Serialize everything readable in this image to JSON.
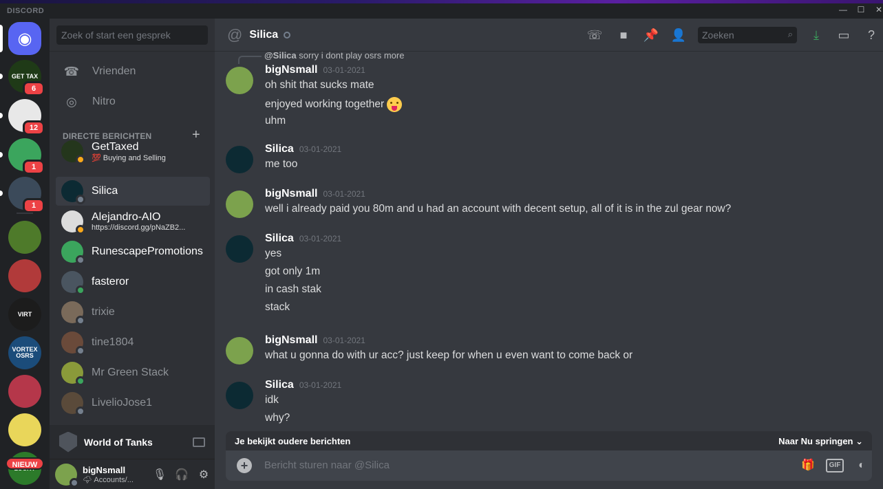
{
  "window": {
    "brand": "DISCORD",
    "minimize": "—",
    "maximize": "☐",
    "close": "✕"
  },
  "guilds": {
    "items": [
      {
        "name": "home",
        "label": "",
        "color": "#5865f2",
        "badge": ""
      },
      {
        "name": "gettax-server",
        "label": "GET TAX",
        "color": "#1f3a17",
        "badge": "6"
      },
      {
        "name": "dots-server",
        "label": "",
        "color": "#e8e8e8",
        "badge": "12"
      },
      {
        "name": "discord-green-server",
        "label": "",
        "color": "#3ba55d",
        "badge": "1"
      },
      {
        "name": "car-server",
        "label": "",
        "color": "#3b4a5a",
        "badge": "1"
      },
      {
        "name": "tree-server",
        "label": "",
        "color": "#4e7a2a",
        "badge": ""
      },
      {
        "name": "flag-server",
        "label": "",
        "color": "#b13a3a",
        "badge": ""
      },
      {
        "name": "virt-server",
        "label": "VIRT",
        "color": "#1c1c1c",
        "badge": ""
      },
      {
        "name": "vortex-server",
        "label": "VORTEX OSRS",
        "color": "#1b4c7a",
        "badge": ""
      },
      {
        "name": "bull-server",
        "label": "",
        "color": "#b5374a",
        "badge": ""
      },
      {
        "name": "cartoon-server",
        "label": "",
        "color": "#e9d65a",
        "badge": ""
      },
      {
        "name": "lucky-server",
        "label": "LUCKY",
        "color": "#2c7a2a",
        "badge": ""
      }
    ],
    "new_label": "NIEUW"
  },
  "sidebar": {
    "search_placeholder": "Zoek of start een gesprek",
    "nav": [
      {
        "label": "Vrienden"
      },
      {
        "label": "Nitro"
      }
    ],
    "dm_header": "DIRECTE BERICHTEN",
    "dm_add": "+",
    "dms": [
      {
        "name": "GetTaxed",
        "sub": "💯 Buying and Selling",
        "color": "#24361c",
        "status": "idle",
        "bright": true
      },
      {
        "name": "Silica",
        "sub": "",
        "color": "#0c2a33",
        "status": "off",
        "active": true
      },
      {
        "name": "Alejandro-AIO",
        "sub": "https://discord.gg/pNaZB2...",
        "color": "#dcdcdc",
        "status": "idle",
        "bright": true
      },
      {
        "name": "RunescapePromotions",
        "sub": "",
        "color": "#3ba55d",
        "status": "off",
        "bright": true
      },
      {
        "name": "fasteror",
        "sub": "",
        "color": "#4a5560",
        "status": "on",
        "bright": true
      },
      {
        "name": "trixie",
        "sub": "",
        "color": "#7a6a5a",
        "status": "off"
      },
      {
        "name": "tine1804",
        "sub": "",
        "color": "#6a4a3a",
        "status": "off"
      },
      {
        "name": "Mr Green Stack",
        "sub": "",
        "color": "#8a9a3a",
        "status": "on"
      },
      {
        "name": "LivelioJose1",
        "sub": "",
        "color": "#5a4a3a",
        "status": "off"
      }
    ],
    "game": {
      "name": "World of Tanks"
    },
    "user": {
      "name": "bigNsmall",
      "status": "🌩 Accounts/...",
      "mic": "🎙",
      "headset": "🎧",
      "settings": "⚙"
    }
  },
  "header": {
    "at": "@",
    "name": "Silica",
    "search_placeholder": "Zoeken",
    "icons": [
      "phone-icon",
      "video-icon",
      "pin-icon",
      "add-friend-icon",
      "download-icon",
      "inbox-icon",
      "help-icon"
    ]
  },
  "reply": {
    "author": "@Silica",
    "text": "sorry i dont play osrs more"
  },
  "messages": [
    {
      "author": "bigNsmall",
      "ts": "03-01-2021",
      "lines": [
        "oh shit that sucks mate",
        "enjoyed working together",
        "uhm"
      ],
      "emoji_line": 1
    },
    {
      "author": "Silica",
      "ts": "03-01-2021",
      "lines": [
        "me too"
      ]
    },
    {
      "author": "bigNsmall",
      "ts": "03-01-2021",
      "lines": [
        "well i already paid you 80m and u had an account with decent setup, all of it is in the zul gear now?"
      ]
    },
    {
      "author": "Silica",
      "ts": "03-01-2021",
      "lines": [
        "yes",
        "got only 1m",
        "in cash stak",
        "stack"
      ]
    },
    {
      "author": "bigNsmall",
      "ts": "03-01-2021",
      "lines": [
        "what u gonna do with ur acc? just keep for when u even want to come back or"
      ]
    },
    {
      "author": "Silica",
      "ts": "03-01-2021",
      "lines": [
        "idk",
        "why?"
      ]
    }
  ],
  "older_bar": {
    "left": "Je bekijkt oudere berichten",
    "right": "Naar Nu springen ⌄"
  },
  "composer": {
    "placeholder": "Bericht sturen naar @Silica",
    "gif": "GIF"
  }
}
